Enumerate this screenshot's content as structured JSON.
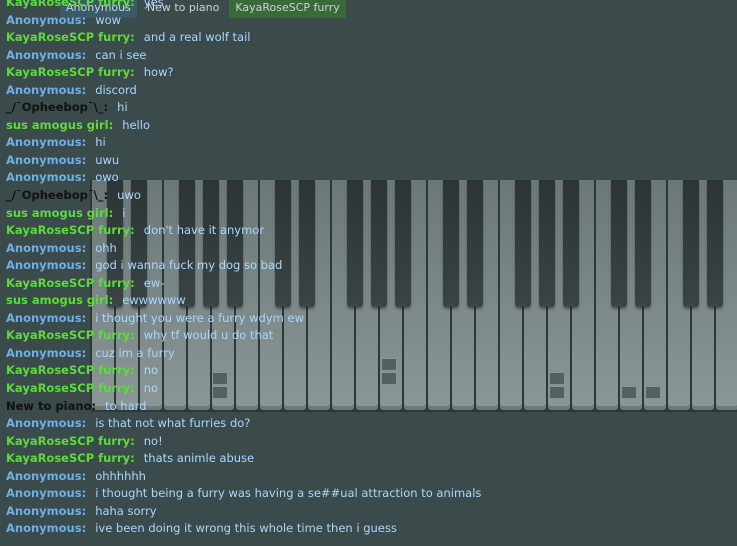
{
  "users": [
    {
      "name": "Anonymous",
      "color": "#6db0e8"
    },
    {
      "name": "New to piano",
      "color": "#dcdcdc"
    },
    {
      "name": "KayaRoseSCP furry",
      "color": "#5cdc3c"
    }
  ],
  "messages": [
    {
      "nick": "KayaRoseSCP furry:",
      "text": "yes",
      "color": "#5cdc3c"
    },
    {
      "nick": "Anonymous:",
      "text": "wow",
      "color": "#6db0e8"
    },
    {
      "nick": "KayaRoseSCP furry:",
      "text": "and a real wolf tail",
      "color": "#5cdc3c"
    },
    {
      "nick": "Anonymous:",
      "text": "can i see",
      "color": "#6db0e8"
    },
    {
      "nick": "KayaRoseSCP furry:",
      "text": "how?",
      "color": "#5cdc3c"
    },
    {
      "nick": "Anonymous:",
      "text": "discord",
      "color": "#6db0e8"
    },
    {
      "nick": "_/¯Opheebop¯\\_:",
      "text": "hi",
      "color": "#111111"
    },
    {
      "nick": "sus amogus girl:",
      "text": "hello",
      "color": "#5cdc3c"
    },
    {
      "nick": "Anonymous:",
      "text": "hi",
      "color": "#6db0e8"
    },
    {
      "nick": "Anonymous:",
      "text": "uwu",
      "color": "#6db0e8"
    },
    {
      "nick": "Anonymous:",
      "text": "owo",
      "color": "#6db0e8"
    },
    {
      "nick": "_/¯Opheebop¯\\_:",
      "text": "uwo",
      "color": "#111111"
    },
    {
      "nick": "sus amogus girl:",
      "text": "i",
      "color": "#5cdc3c"
    },
    {
      "nick": "KayaRoseSCP furry:",
      "text": "don't have it anymor",
      "color": "#5cdc3c"
    },
    {
      "nick": "Anonymous:",
      "text": "ohh",
      "color": "#6db0e8"
    },
    {
      "nick": "Anonymous:",
      "text": "god i wanna fuck my dog so bad",
      "color": "#6db0e8"
    },
    {
      "nick": "KayaRoseSCP furry:",
      "text": "ew-",
      "color": "#5cdc3c"
    },
    {
      "nick": "sus amogus girl:",
      "text": "ewwwwww",
      "color": "#5cdc3c"
    },
    {
      "nick": "Anonymous:",
      "text": "i thought you were a furry wdym ew",
      "color": "#6db0e8"
    },
    {
      "nick": "KayaRoseSCP furry:",
      "text": "why tf would u do that",
      "color": "#5cdc3c"
    },
    {
      "nick": "Anonymous:",
      "text": "cuz im a furry",
      "color": "#6db0e8"
    },
    {
      "nick": "KayaRoseSCP furry:",
      "text": "no",
      "color": "#5cdc3c"
    },
    {
      "nick": "KayaRoseSCP furry:",
      "text": "no",
      "color": "#5cdc3c"
    },
    {
      "nick": "New to piano:",
      "text": "to hard",
      "color": "#111111"
    },
    {
      "nick": "Anonymous:",
      "text": "is that not what furries do?",
      "color": "#6db0e8"
    },
    {
      "nick": "KayaRoseSCP furry:",
      "text": "no!",
      "color": "#5cdc3c"
    },
    {
      "nick": "KayaRoseSCP furry:",
      "text": "thats animle abuse",
      "color": "#5cdc3c"
    },
    {
      "nick": "Anonymous:",
      "text": "ohhhhhh",
      "color": "#6db0e8"
    },
    {
      "nick": "Anonymous:",
      "text": "i thought being a furry was having a se##ual attraction to animals",
      "color": "#6db0e8"
    },
    {
      "nick": "Anonymous:",
      "text": "haha sorry",
      "color": "#6db0e8"
    },
    {
      "nick": "Anonymous:",
      "text": "ive been doing it wrong this whole time then i guess",
      "color": "#6db0e8"
    }
  ],
  "colors": {
    "background": "#3b4a4a",
    "message_text": "#a8d8ff"
  }
}
